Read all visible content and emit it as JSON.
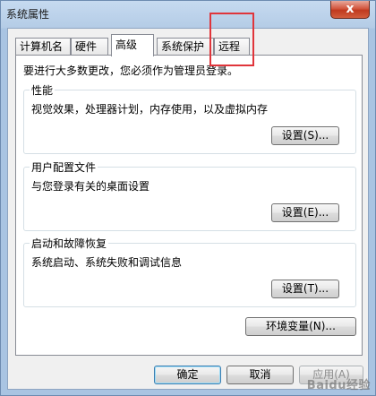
{
  "window": {
    "title": "系统属性",
    "close_glyph": "x"
  },
  "tabs": [
    {
      "label": "计算机名"
    },
    {
      "label": "硬件"
    },
    {
      "label": "高级",
      "active": true
    },
    {
      "label": "系统保护"
    },
    {
      "label": "远程"
    }
  ],
  "panel": {
    "intro": "要进行大多数更改，您必须作为管理员登录。",
    "groups": [
      {
        "title": "性能",
        "desc": "视觉效果，处理器计划，内存使用，以及虚拟内存",
        "button": "设置(S)..."
      },
      {
        "title": "用户配置文件",
        "desc": "与您登录有关的桌面设置",
        "button": "设置(E)..."
      },
      {
        "title": "启动和故障恢复",
        "desc": "系统启动、系统失败和调试信息",
        "button": "设置(T)..."
      }
    ],
    "env_button": "环境变量(N)..."
  },
  "footer": {
    "ok": "确定",
    "cancel": "取消",
    "apply": "应用(A)"
  },
  "watermark": "Baidu经验",
  "colors": {
    "highlight": "#e0353b",
    "close_button": "#c0391f",
    "title_bar": "#b4cce6"
  }
}
